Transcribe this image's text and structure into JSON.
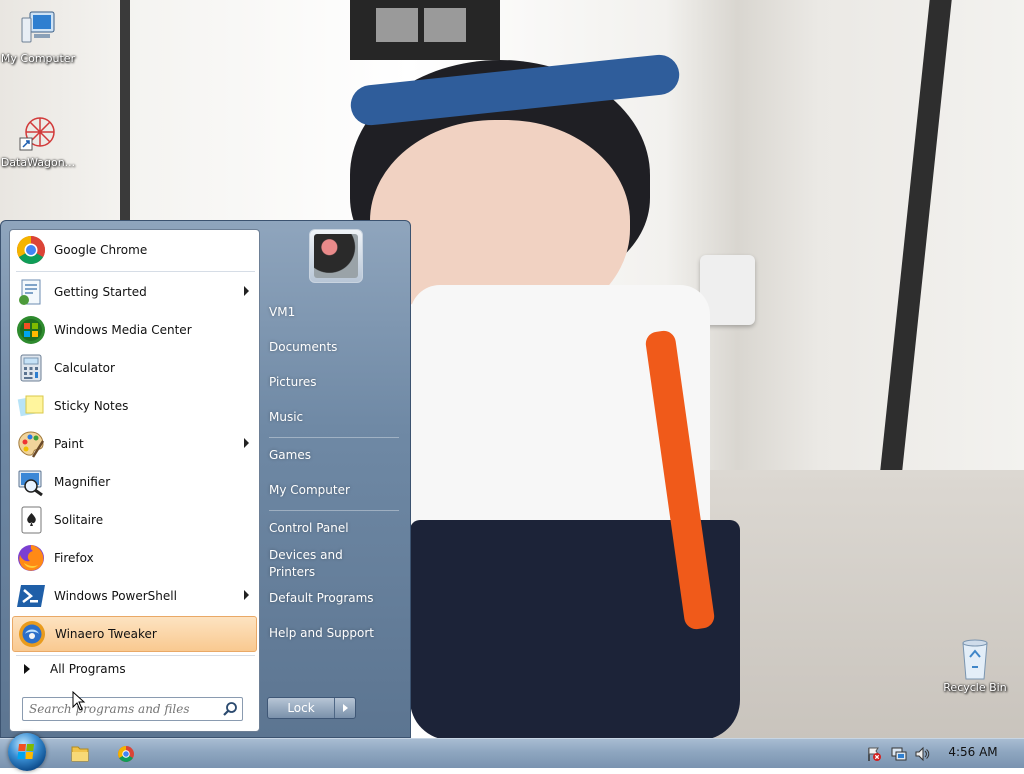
{
  "desktop": {
    "icons": [
      {
        "label": "My Computer"
      },
      {
        "label": "DataWagon..."
      },
      {
        "label": "Recycle Bin"
      }
    ]
  },
  "start_menu": {
    "programs": [
      {
        "label": "Google Chrome",
        "has_submenu": false
      },
      {
        "label": "Getting Started",
        "has_submenu": true
      },
      {
        "label": "Windows Media Center",
        "has_submenu": false
      },
      {
        "label": "Calculator",
        "has_submenu": false
      },
      {
        "label": "Sticky Notes",
        "has_submenu": false
      },
      {
        "label": "Paint",
        "has_submenu": true
      },
      {
        "label": "Magnifier",
        "has_submenu": false
      },
      {
        "label": "Solitaire",
        "has_submenu": false
      },
      {
        "label": "Firefox",
        "has_submenu": false
      },
      {
        "label": "Windows PowerShell",
        "has_submenu": true
      },
      {
        "label": "Winaero Tweaker",
        "has_submenu": false,
        "highlighted": true
      }
    ],
    "all_programs_label": "All Programs",
    "search_placeholder": "Search programs and files",
    "right_links": {
      "user": "VM1",
      "documents": "Documents",
      "pictures": "Pictures",
      "music": "Music",
      "games": "Games",
      "my_computer": "My Computer",
      "control_panel": "Control Panel",
      "devices_printers": "Devices and Printers",
      "default_programs": "Default Programs",
      "help_support": "Help and Support"
    },
    "lock_label": "Lock"
  },
  "taskbar": {
    "pinned": [
      "windows-explorer",
      "google-chrome"
    ],
    "tray_icons": [
      "action-center-flag-icon",
      "network-icon",
      "volume-icon"
    ],
    "clock": "4:56 AM"
  }
}
